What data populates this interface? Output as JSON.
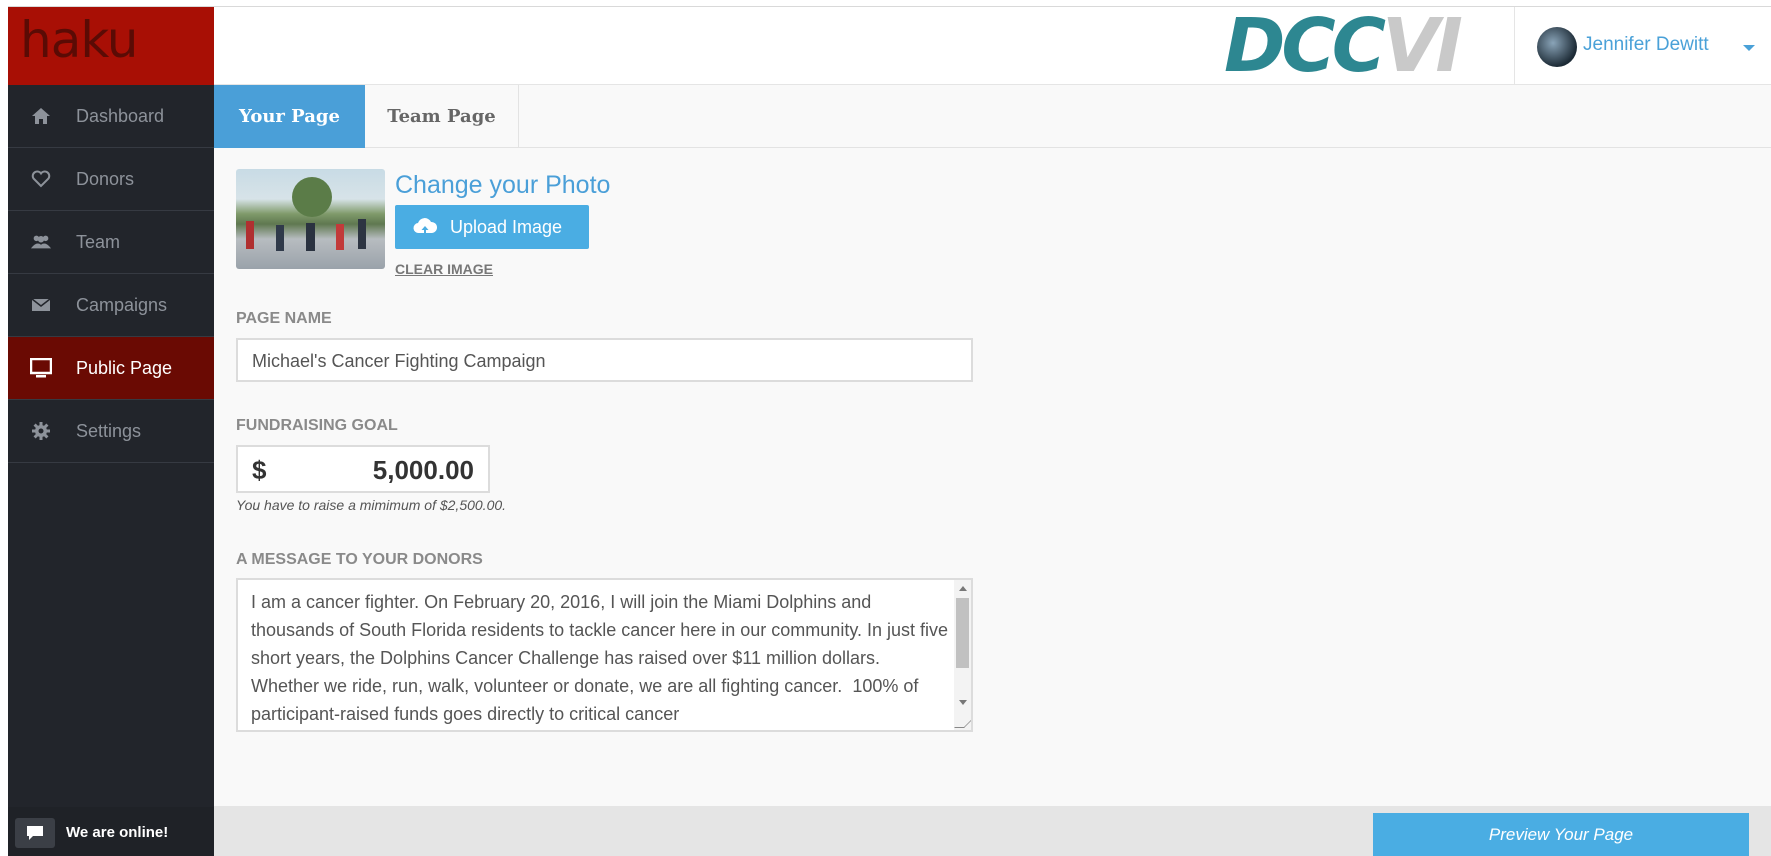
{
  "sidebar": {
    "logo": "haku",
    "items": [
      {
        "label": "Dashboard",
        "icon": "home-icon"
      },
      {
        "label": "Donors",
        "icon": "heart-icon"
      },
      {
        "label": "Team",
        "icon": "team-icon"
      },
      {
        "label": "Campaigns",
        "icon": "envelope-icon"
      },
      {
        "label": "Public Page",
        "icon": "monitor-icon",
        "active": true
      },
      {
        "label": "Settings",
        "icon": "gear-icon"
      }
    ],
    "chat_label": "We are online!"
  },
  "header": {
    "brand_part1": "DCC",
    "brand_part2": "VI",
    "user_name": "Jennifer Dewitt"
  },
  "tabs": [
    {
      "label": "Your Page",
      "active": true
    },
    {
      "label": "Team Page",
      "active": false
    }
  ],
  "photo": {
    "title": "Change your Photo",
    "upload_label": "Upload Image",
    "clear_label": "CLEAR IMAGE"
  },
  "form": {
    "page_name_label": "PAGE NAME",
    "page_name_value": "Michael's Cancer Fighting Campaign",
    "goal_label": "FUNDRAISING GOAL",
    "goal_currency": "$",
    "goal_amount": "5,000.00",
    "goal_hint": "You have to raise a mimimum of $2,500.00.",
    "message_label": "A MESSAGE TO YOUR DONORS",
    "message_value": "I am a cancer fighter. On February 20, 2016, I will join the Miami Dolphins and thousands of South Florida residents to tackle cancer here in our community. In just five short years, the Dolphins Cancer Challenge has raised over $11 million dollars. Whether we ride, run, walk, volunteer or donate, we are all fighting cancer.  100% of participant-raised funds goes directly to critical cancer"
  },
  "footer": {
    "preview_label": "Preview Your Page"
  },
  "colors": {
    "accent": "#4a9fd8",
    "brand_red": "#a80f05",
    "sidebar_bg": "#22252b",
    "active_nav": "#6a0a03"
  }
}
